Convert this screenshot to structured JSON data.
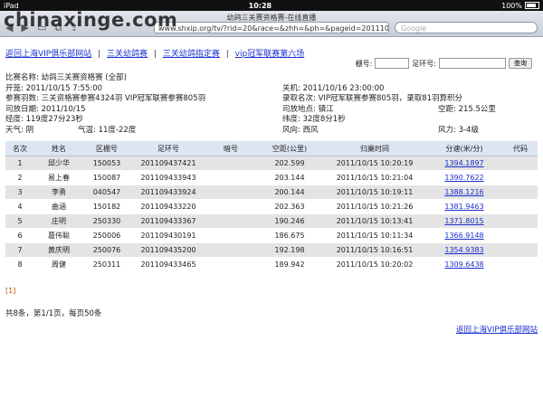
{
  "statusbar": {
    "device": "iPad",
    "time": "10:28",
    "battery": "100%"
  },
  "browser": {
    "page_title": "幼鸽三关赛资格赛-在线直播",
    "url": "www.shxip.org/tv/?rid=20&race=&zhh=&ph=&pageid=201110159...",
    "search_placeholder": "Google",
    "watermark": "chinaxinge.com"
  },
  "links": [
    "返回上海VIP俱乐部网站",
    "三关幼鸽赛",
    "三关幼鸽指定赛",
    "vip冠军联赛第六场"
  ],
  "search": {
    "label_ring": "棚号:",
    "label_foot": "足环号:",
    "button": "查询"
  },
  "info": {
    "race_name": "比赛名称: 幼鸽三关赛资格赛 (全部)",
    "open": "开笼: 2011/10/15 7:55:00",
    "close": "关机: 2011/10/16 23:00:00",
    "entries": "参赛羽数: 三关资格赛参赛4324羽 VIP冠军联赛参赛805羽",
    "awards": "录取名次: VIP冠军联赛参赛805羽，录取81羽算积分",
    "release_date": "司放日期: 2011/10/15",
    "release_place": "司放地点: 镇江",
    "distance": "空距: 215.5公里",
    "longitude": "经度: 119度27分23秒",
    "latitude": "纬度: 32度8分1秒",
    "weather": "天气: 阴",
    "temp": "气温: 11度-22度",
    "wind_dir": "风向: 西风",
    "wind_force": "风力: 3-4级"
  },
  "table": {
    "headers": [
      "名次",
      "姓名",
      "区棚号",
      "足环号",
      "暗号",
      "空距(公里)",
      "归巢时间",
      "分速(米/分)",
      "代码"
    ],
    "rows": [
      [
        "1",
        "邱少华",
        "150053",
        "201109437421",
        "",
        "202.599",
        "2011/10/15 10:20:19",
        "1394.1897",
        ""
      ],
      [
        "2",
        "易上春",
        "150087",
        "201109433943",
        "",
        "203.144",
        "2011/10/15 10:21:04",
        "1390.7622",
        ""
      ],
      [
        "3",
        "李勇",
        "040547",
        "201109433924",
        "",
        "200.144",
        "2011/10/15 10:19:11",
        "1388.1216",
        ""
      ],
      [
        "4",
        "曲涵",
        "150182",
        "201109433220",
        "",
        "202.363",
        "2011/10/15 10:21:26",
        "1381.9463",
        ""
      ],
      [
        "5",
        "庄明",
        "250330",
        "201109433367",
        "",
        "190.246",
        "2011/10/15 10:13:41",
        "1371.8015",
        ""
      ],
      [
        "6",
        "葛伟聪",
        "250006",
        "201109430191",
        "",
        "186.675",
        "2011/10/15 10:11:34",
        "1366.9148",
        ""
      ],
      [
        "7",
        "黄庆明",
        "250076",
        "201109435200",
        "",
        "192.198",
        "2011/10/15 10:16:51",
        "1354.9383",
        ""
      ],
      [
        "8",
        "周健",
        "250311",
        "201109433465",
        "",
        "189.942",
        "2011/10/15 10:20:02",
        "1309.6438",
        ""
      ]
    ]
  },
  "pager": "[1]",
  "summary": "共8条，第1/1页，每页50条",
  "return_link": "返回上海VIP俱乐部网站"
}
